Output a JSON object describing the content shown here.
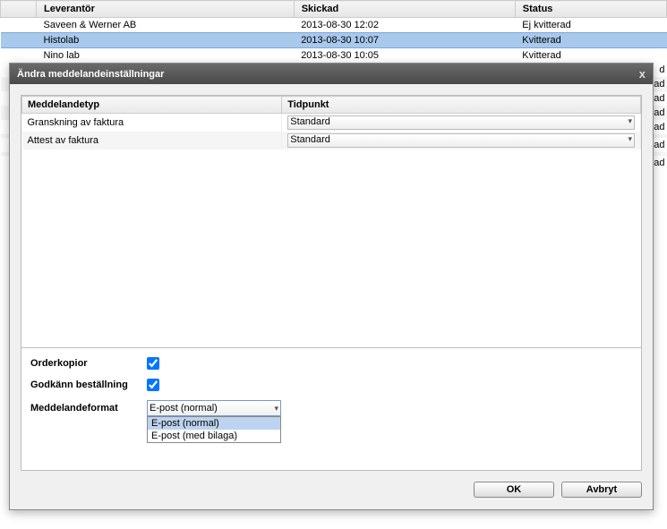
{
  "bgTable": {
    "headers": [
      "Leverantör",
      "Skickad",
      "Status"
    ],
    "rows": [
      {
        "sup": "Saveen & Werner AB",
        "sent": "2013-08-30 12:02",
        "stat": "Ej kvitterad",
        "cls": ""
      },
      {
        "sup": "Histolab",
        "sent": "2013-08-30 10:07",
        "stat": "Kvitterad",
        "cls": "selected"
      },
      {
        "sup": "Nino lab",
        "sent": "2013-08-30 10:05",
        "stat": "Kvitterad",
        "cls": ""
      }
    ],
    "trailer": [
      "d",
      "ad",
      "ad",
      "ad",
      "ad",
      "",
      "ad",
      "",
      "ad"
    ]
  },
  "dialog": {
    "title": "Ändra meddelandeinställningar",
    "close": "x",
    "grid": {
      "headers": [
        "Meddelandetyp",
        "Tidpunkt"
      ],
      "rows": [
        {
          "type": "Granskning av faktura",
          "time": "Standard"
        },
        {
          "type": "Attest av faktura",
          "time": "Standard"
        }
      ]
    },
    "form": {
      "orderkopior_label": "Orderkopior",
      "orderkopior_checked": true,
      "godkann_label": "Godkänn beställning",
      "godkann_checked": true,
      "format_label": "Meddelandeformat",
      "format_value": "E-post (normal)",
      "format_options": [
        "E-post (normal)",
        "E-post (med bilaga)"
      ]
    },
    "buttons": {
      "ok": "OK",
      "cancel": "Avbryt"
    }
  }
}
